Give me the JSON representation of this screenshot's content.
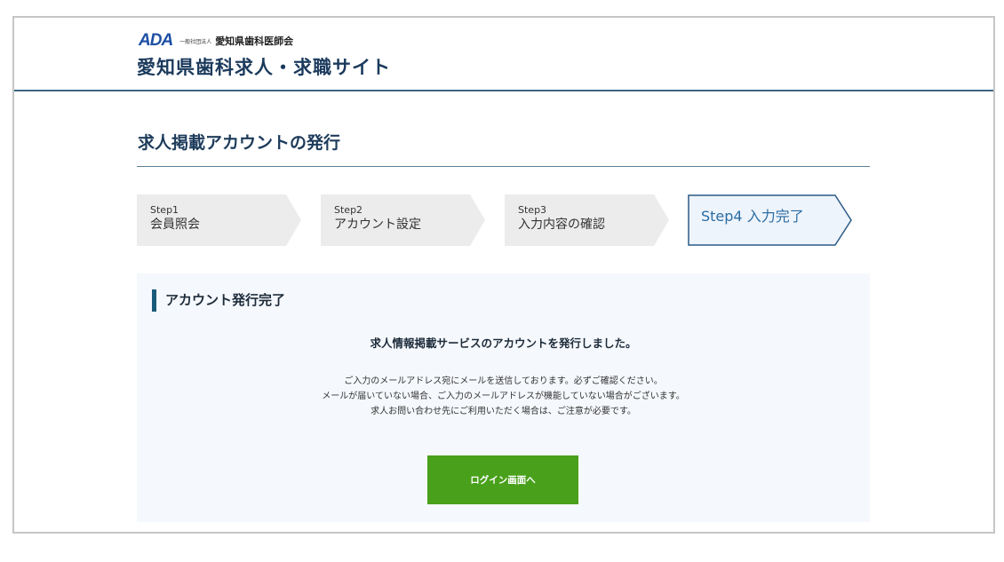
{
  "header": {
    "logo_mark": "ADA",
    "logo_prefix": "一般社団法人",
    "association_name": "愛知県歯科医師会",
    "site_title": "愛知県歯科求人・求職サイト"
  },
  "page": {
    "title": "求人掲載アカウントの発行"
  },
  "steps": [
    {
      "num": "Step1",
      "name": "会員照会",
      "active": false
    },
    {
      "num": "Step2",
      "name": "アカウント設定",
      "active": false
    },
    {
      "num": "Step3",
      "name": "入力内容の確認",
      "active": false
    },
    {
      "num": "Step4",
      "name": "入力完了",
      "active": true
    }
  ],
  "panel": {
    "heading": "アカウント発行完了",
    "message": "求人情報掲載サービスのアカウントを発行しました。",
    "notes": [
      "ご入力のメールアドレス宛にメールを送信しております。必ずご確認ください。",
      "メールが届いていない場合、ご入力のメールアドレスが機能していない場合がございます。",
      "求人お問い合わせ先にご利用いただく場合は、ご注意が必要です。"
    ],
    "login_button": "ログイン画面へ"
  },
  "colors": {
    "accent": "#1a5a7a",
    "active_step_border": "#2c5b86",
    "button": "#49a01b",
    "panel_bg": "#f5f8fc"
  }
}
